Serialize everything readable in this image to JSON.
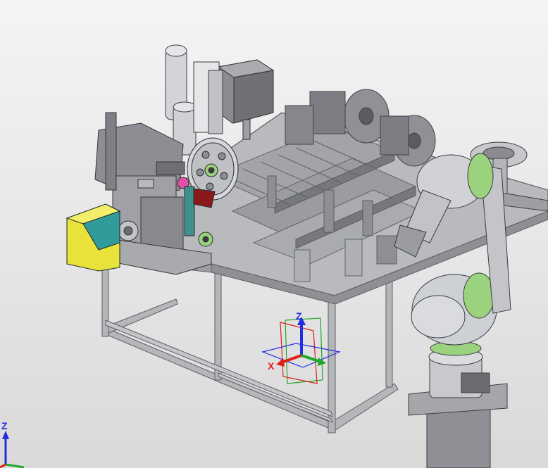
{
  "viewport": {
    "background_top": "#f4f4f4",
    "background_bottom": "#d9d9d9"
  },
  "colors": {
    "frame": "#a7a9ad",
    "frame_dark": "#6e7075",
    "plate": "#b9bbbf",
    "steel": "#c9ccd1",
    "robot": "#c7c9cd",
    "accent_green": "#9bd27d",
    "enclosure_yellow": "#e8e23a",
    "enclosure_teal": "#2f9c9b",
    "axis_x": "#e0201a",
    "axis_y": "#1fa82a",
    "axis_z": "#1f2ee0"
  },
  "triad": {
    "x_label": "X",
    "z_label": "Z"
  },
  "corner_triad": {
    "z_label": "Z"
  },
  "icons": [
    "reference-triad-icon",
    "orientation-triad-icon"
  ]
}
